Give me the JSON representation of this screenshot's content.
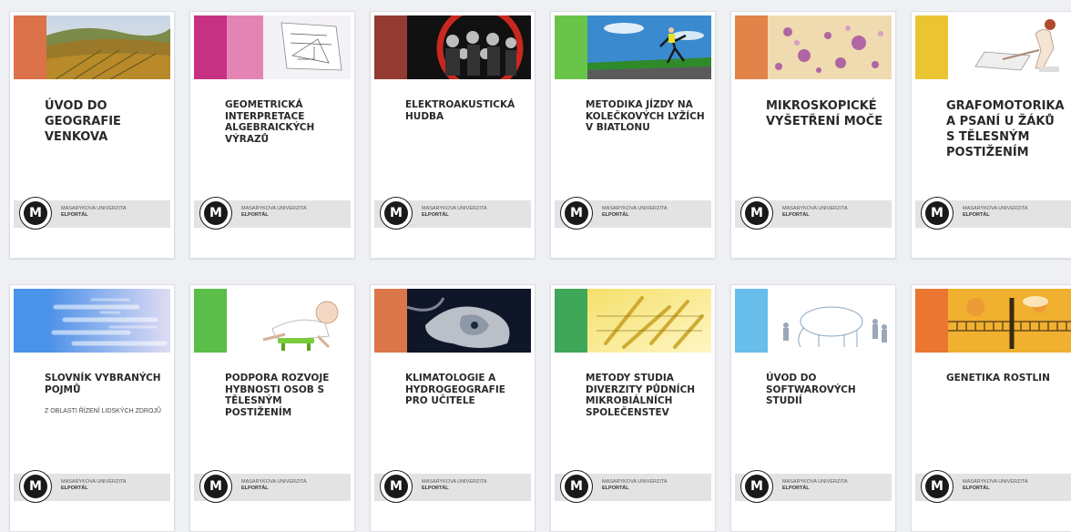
{
  "colors": {
    "page_background": "#eef0f3",
    "card_background": "#ffffff",
    "footer_band": "#e3e3e3",
    "title_text": "#2a2a2a"
  },
  "footer": {
    "university": "Masarykova univerzita",
    "portal": "Elportál"
  },
  "logo_glyph": "M",
  "cards": [
    {
      "title": "Úvod do geografie venkova",
      "subtitle": "",
      "stripe_color": "#d9663a",
      "art": "vineyard-photo"
    },
    {
      "title": "Geometrická interpretace algebraických výrazů",
      "subtitle": "",
      "stripe_color": "#c2207a",
      "art": "geometry-drawing"
    },
    {
      "title": "Elektroakustická hudba",
      "subtitle": "",
      "stripe_color": "#8a2a22",
      "art": "band-photo"
    },
    {
      "title": "Metodika jízdy na kolečkových lyžích v biatlonu",
      "subtitle": "",
      "stripe_color": "#5cc03a",
      "art": "rollerski-photo"
    },
    {
      "title": "Mikroskopické vyšetření moče",
      "subtitle": "",
      "stripe_color": "#e07a3a",
      "art": "microscope-photo"
    },
    {
      "title": "Grafomotorika a psaní u žáků s tělesným postižením",
      "subtitle": "",
      "stripe_color": "#e8c020",
      "art": "writing-illustration"
    },
    {
      "title": "Slovník vybraných pojmů",
      "subtitle": "z oblasti řízení lidských zdrojů",
      "stripe_color": "#3a8ae8",
      "art": "word-cloud"
    },
    {
      "title": "Podpora rozvoje hybnosti osob s tělesným postižením",
      "subtitle": "",
      "stripe_color": "#4cb83a",
      "art": "baby-illustration"
    },
    {
      "title": "Klimatologie a hydrogeografie pro učitele",
      "subtitle": "",
      "stripe_color": "#d86a3a",
      "art": "satellite-photo"
    },
    {
      "title": "Metody studia diverzity půdních mikrobiálních společenstev",
      "subtitle": "",
      "stripe_color": "#2ea04a",
      "art": "microbes-illustration"
    },
    {
      "title": "Úvod do softwarových studií",
      "subtitle": "",
      "stripe_color": "#5ab8e8",
      "art": "elephant-sketch"
    },
    {
      "title": "Genetika rostlin",
      "subtitle": "",
      "stripe_color": "#e86a20",
      "art": "membrane-illustration"
    }
  ]
}
